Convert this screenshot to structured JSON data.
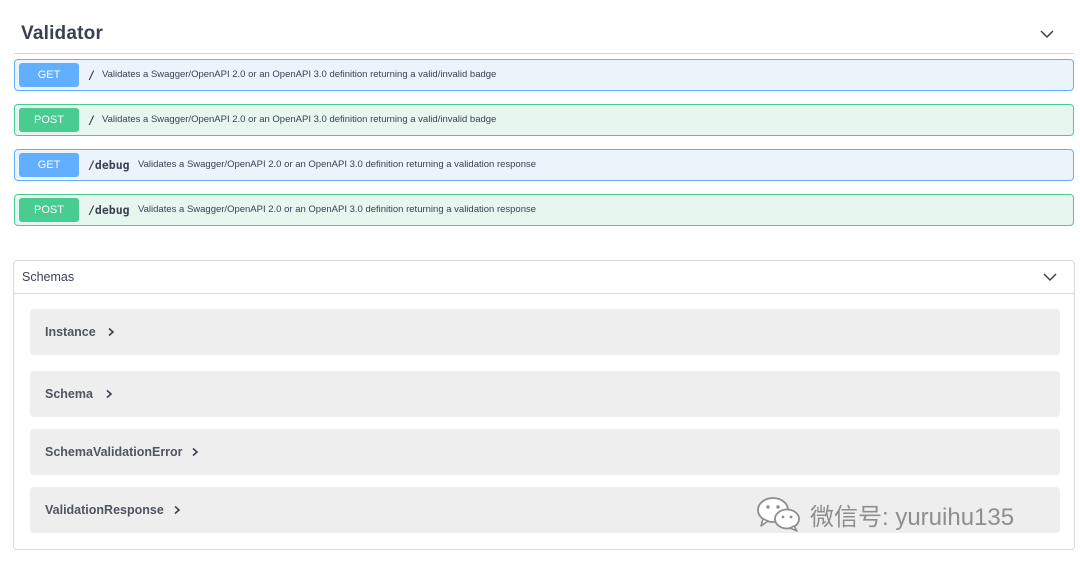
{
  "validator": {
    "title": "Validator",
    "toggle_icon": "chevron-down-icon"
  },
  "operations": [
    {
      "method": "GET",
      "path": "/",
      "description": "Validates a Swagger/OpenAPI 2.0 or an OpenAPI 3.0 definition returning a valid/invalid badge"
    },
    {
      "method": "POST",
      "path": "/",
      "description": "Validates a Swagger/OpenAPI 2.0 or an OpenAPI 3.0 definition returning a valid/invalid badge"
    },
    {
      "method": "GET",
      "path": "/debug",
      "description": "Validates a Swagger/OpenAPI 2.0 or an OpenAPI 3.0 definition returning a validation response"
    },
    {
      "method": "POST",
      "path": "/debug",
      "description": "Validates a Swagger/OpenAPI 2.0 or an OpenAPI 3.0 definition returning a validation response"
    }
  ],
  "schemas": {
    "title": "Schemas",
    "toggle_icon": "chevron-down-icon",
    "models": [
      {
        "name": "Instance"
      },
      {
        "name": "Schema"
      },
      {
        "name": "SchemaValidationError"
      },
      {
        "name": "ValidationResponse"
      }
    ]
  },
  "watermark": {
    "text": "微信号: yuruihu135",
    "icon": "wechat-logo-icon"
  },
  "colors": {
    "get": "#61affe",
    "post": "#49cc90",
    "get_bg": "#ebf3fb",
    "post_bg": "#e8f6f0",
    "text": "#3b4151"
  }
}
